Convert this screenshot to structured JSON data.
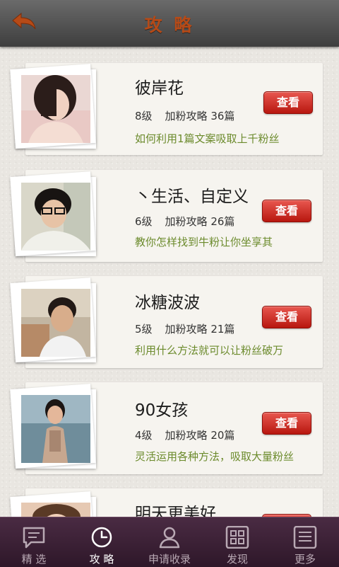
{
  "header": {
    "title": "攻 略",
    "back_icon": "back-arrow-icon"
  },
  "colors": {
    "title": "#b64a17",
    "accent_button": "#c92a20",
    "description": "#6c8b2d",
    "tabbar": "#3a2034"
  },
  "cards": [
    {
      "name": "彼岸花",
      "level": "8级",
      "guide_label": "加粉攻略",
      "guide_count": "36篇",
      "description": "如何利用1篇文案吸取上千粉丝",
      "button": "查看"
    },
    {
      "name": "丶生活、自定义",
      "level": "6级",
      "guide_label": "加粉攻略",
      "guide_count": "26篇",
      "description": "教你怎样找到牛粉让你坐享其",
      "button": "查看"
    },
    {
      "name": "冰糖波波",
      "level": "5级",
      "guide_label": "加粉攻略",
      "guide_count": "21篇",
      "description": "利用什么方法就可以让粉丝破万",
      "button": "查看"
    },
    {
      "name": "90女孩",
      "level": "4级",
      "guide_label": "加粉攻略",
      "guide_count": "20篇",
      "description": "灵活运用各种方法，吸取大量粉丝",
      "button": "查看"
    },
    {
      "name": "明天更美好",
      "level": "",
      "guide_label": "",
      "guide_count": "",
      "description": "",
      "button": ""
    }
  ],
  "tabs": [
    {
      "label": "精 选",
      "icon": "message-icon"
    },
    {
      "label": "攻 略",
      "icon": "clock-icon"
    },
    {
      "label": "申请收录",
      "icon": "user-icon"
    },
    {
      "label": "发现",
      "icon": "grid-icon"
    },
    {
      "label": "更多",
      "icon": "list-icon"
    }
  ]
}
